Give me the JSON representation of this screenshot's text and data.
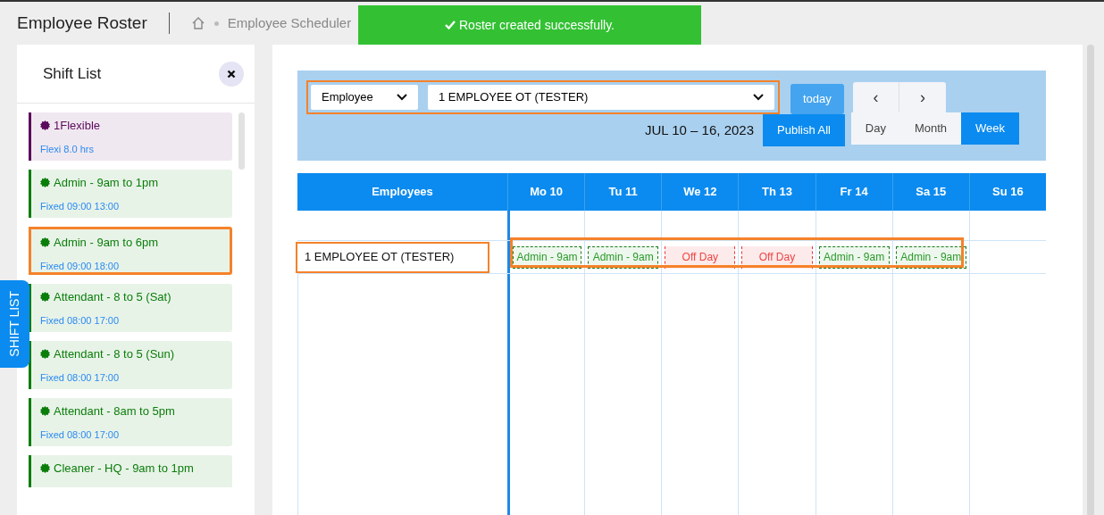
{
  "header": {
    "title": "Employee Roster",
    "breadcrumbs": [
      "Employee Scheduler"
    ]
  },
  "toast": {
    "message": "Roster created successfully."
  },
  "shift_list": {
    "title": "Shift List",
    "tab_label": "SHIFT LIST",
    "items": [
      {
        "name": "1Flexible",
        "detail": "Flexi 8.0 hrs",
        "color": "#5c0a5c",
        "highlighted": false
      },
      {
        "name": "Admin - 9am to 1pm",
        "detail": "Fixed 09:00 13:00",
        "color": "#0a7d0a",
        "highlighted": false
      },
      {
        "name": "Admin - 9am to 6pm",
        "detail": "Fixed 09:00 18:00",
        "color": "#0a7d0a",
        "highlighted": true
      },
      {
        "name": "Attendant - 8 to 5 (Sat)",
        "detail": "Fixed 08:00 17:00",
        "color": "#0a7d0a",
        "highlighted": false
      },
      {
        "name": "Attendant - 8 to 5 (Sun)",
        "detail": "Fixed 08:00 17:00",
        "color": "#0a7d0a",
        "highlighted": false
      },
      {
        "name": "Attendant - 8am to 5pm",
        "detail": "Fixed 08:00 17:00",
        "color": "#0a7d0a",
        "highlighted": false
      },
      {
        "name": "Cleaner - HQ - 9am to 1pm",
        "color": "#0a7d0a",
        "highlighted": false
      }
    ]
  },
  "toolbar": {
    "filters_highlighted": true,
    "filter_type": "Employee",
    "employee": "1 EMPLOYEE OT (TESTER)",
    "today": "today",
    "range": "JUL 10 – 16, 2023",
    "publish": "Publish All",
    "prev": "‹",
    "next": "›",
    "views": [
      {
        "label": "Day",
        "selected": false
      },
      {
        "label": "Month",
        "selected": false
      },
      {
        "label": "Week",
        "selected": true
      }
    ]
  },
  "calendar": {
    "columns": [
      "Employees",
      "Mo 10",
      "Tu 11",
      "We 12",
      "Th 13",
      "Fr 14",
      "Sa 15",
      "Su 16"
    ],
    "rows": [
      {
        "employee": "1 EMPLOYEE OT (TESTER)",
        "highlighted": true,
        "events": [
          {
            "kind": "shift",
            "label": "Admin - 9am"
          },
          {
            "kind": "shift",
            "label": "Admin - 9am"
          },
          {
            "kind": "off",
            "label": "Off Day"
          },
          {
            "kind": "off",
            "label": "Off Day"
          },
          {
            "kind": "shift",
            "label": "Admin - 9am"
          },
          {
            "kind": "shift",
            "label": "Admin - 9am"
          },
          {
            "kind": "none"
          }
        ]
      }
    ]
  }
}
